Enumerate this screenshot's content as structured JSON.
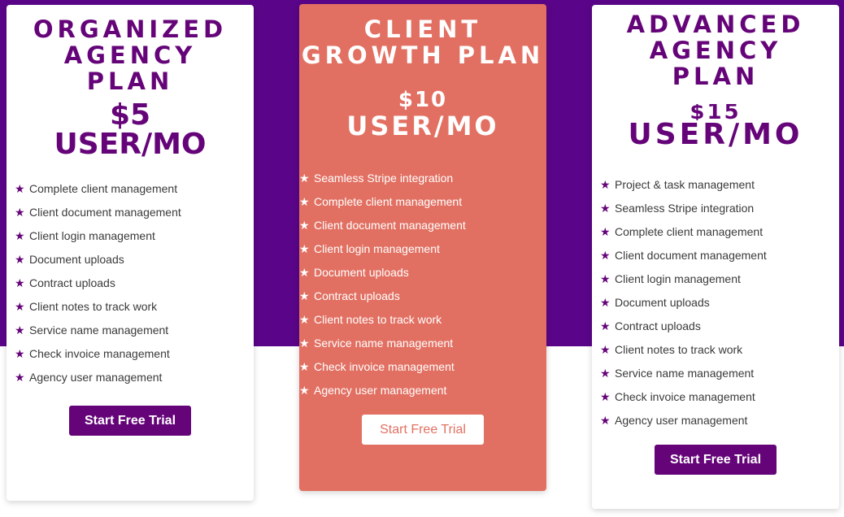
{
  "colors": {
    "background_band": "#5a0589",
    "brand_purple": "#650479",
    "featured_coral": "#e27062",
    "white": "#ffffff"
  },
  "plans": [
    {
      "title": "ORGANIZED AGENCY PLAN",
      "price": "$5",
      "unit": "USER/MO",
      "features": [
        "Complete client management",
        "Client document management",
        "Client login management",
        "Document uploads",
        "Contract uploads",
        "Client notes to track work",
        "Service name management",
        "Check invoice management",
        "Agency user management"
      ],
      "cta": "Start Free Trial"
    },
    {
      "title": "CLIENT GROWTH PLAN",
      "price": "$10",
      "unit": "USER/MO",
      "features": [
        "Seamless Stripe integration",
        "Complete client management",
        "Client document management",
        "Client login management",
        "Document uploads",
        "Contract uploads",
        "Client notes to track work",
        "Service name management",
        "Check invoice management",
        "Agency user management"
      ],
      "cta": "Start Free Trial"
    },
    {
      "title": "ADVANCED AGENCY PLAN",
      "price": "$15",
      "unit": "USER/MO",
      "features": [
        "Project & task management",
        "Seamless Stripe integration",
        "Complete client management",
        "Client document management",
        "Client login management",
        "Document uploads",
        "Contract uploads",
        "Client notes to track work",
        "Service name management",
        "Check invoice management",
        "Agency user management"
      ],
      "cta": "Start Free Trial"
    }
  ],
  "icons": {
    "feature_bullet": "star-icon"
  }
}
